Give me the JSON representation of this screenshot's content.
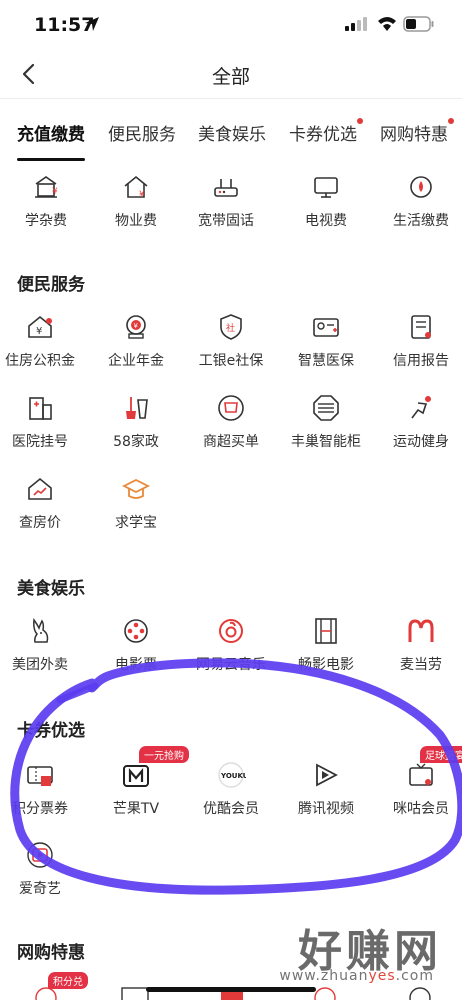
{
  "status": {
    "time": "11:57"
  },
  "nav": {
    "title": "全部"
  },
  "tabs": [
    {
      "label": "充值缴费",
      "active": true,
      "dot": false
    },
    {
      "label": "便民服务",
      "active": false,
      "dot": false
    },
    {
      "label": "美食娱乐",
      "active": false,
      "dot": false
    },
    {
      "label": "卡券优选",
      "active": false,
      "dot": true
    },
    {
      "label": "网购特惠",
      "active": false,
      "dot": true
    }
  ],
  "recharge": {
    "items": [
      "学杂费",
      "物业费",
      "宽带固话",
      "电视费",
      "生活缴费"
    ]
  },
  "convenience": {
    "title": "便民服务",
    "items": [
      "住房公积金",
      "企业年金",
      "工银e社保",
      "智慧医保",
      "信用报告",
      "医院挂号",
      "58家政",
      "商超买单",
      "丰巢智能柜",
      "运动健身",
      "查房价",
      "求学宝"
    ]
  },
  "food": {
    "title": "美食娱乐",
    "items": [
      "美团外卖",
      "电影票",
      "网易云音乐",
      "畅影电影",
      "麦当劳"
    ]
  },
  "coupon": {
    "title": "卡券优选",
    "items": [
      "积分票券",
      "芒果TV",
      "优酷会员",
      "腾讯视频",
      "咪咕会员",
      "爱奇艺"
    ],
    "badge_mango": "一元抢购",
    "badge_migu": "足球盛宴"
  },
  "shopping": {
    "title": "网购特惠",
    "badge": "积分兑"
  },
  "watermark": {
    "main": "好赚网",
    "sub_pre": "www.zhuan",
    "sub_hl": "yes",
    "sub_post": ".com"
  },
  "colors": {
    "accent": "#e23a3a",
    "scribble": "#5b3df0"
  }
}
